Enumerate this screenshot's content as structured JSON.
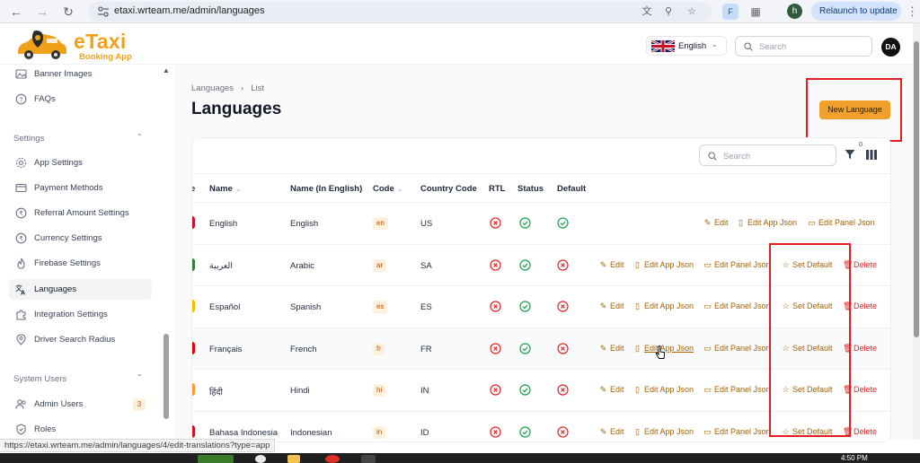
{
  "browser": {
    "url": "etaxi.wrteam.me/admin/languages",
    "relaunch_label": "Relaunch to update",
    "profile_initial": "h",
    "extension_label": "F",
    "status_bar_url": "https://etaxi.wrteam.me/admin/languages/4/edit-translations?type=app"
  },
  "header": {
    "logo_title": "eTaxi",
    "logo_subtitle": "Booking App",
    "language_label": "English",
    "search_placeholder": "Search",
    "avatar_initials": "DA"
  },
  "sidebar": {
    "items_top": [
      {
        "label": "Banner Images",
        "icon": "image-icon"
      },
      {
        "label": "FAQs",
        "icon": "help-circle-icon"
      }
    ],
    "settings_group": "Settings",
    "settings_items": [
      {
        "label": "App Settings",
        "icon": "gear-icon"
      },
      {
        "label": "Payment Methods",
        "icon": "credit-card-icon"
      },
      {
        "label": "Referral Amount Settings",
        "icon": "coin-icon"
      },
      {
        "label": "Currency Settings",
        "icon": "currency-icon"
      },
      {
        "label": "Firebase Settings",
        "icon": "flame-icon"
      },
      {
        "label": "Languages",
        "icon": "translate-icon",
        "active": true
      },
      {
        "label": "Integration Settings",
        "icon": "puzzle-icon"
      },
      {
        "label": "Driver Search Radius",
        "icon": "map-pin-icon"
      }
    ],
    "system_users_group": "System Users",
    "system_users_items": [
      {
        "label": "Admin Users",
        "icon": "users-icon",
        "badge": "3"
      },
      {
        "label": "Roles",
        "icon": "shield-icon"
      }
    ]
  },
  "page": {
    "breadcrumb": [
      "Languages",
      "List"
    ],
    "title": "Languages",
    "new_button_label": "New Language"
  },
  "table": {
    "search_placeholder": "Search",
    "filter_count": "0",
    "columns": {
      "flag": "e",
      "name": "Name",
      "name_en": "Name (In English)",
      "code": "Code",
      "country_code": "Country Code",
      "rtl": "RTL",
      "status": "Status",
      "default": "Default"
    },
    "actions": {
      "edit": "Edit",
      "edit_app_json": "Edit App Json",
      "edit_panel_json": "Edit Panel Json",
      "set_default": "Set Default",
      "delete": "Delete"
    },
    "rows": [
      {
        "name": "English",
        "name_en": "English",
        "code": "en",
        "country": "US",
        "rtl": false,
        "status": true,
        "is_default": true,
        "flag_color": "#c8102e"
      },
      {
        "name": "العربية",
        "name_en": "Arabic",
        "code": "ar",
        "country": "SA",
        "rtl": false,
        "status": true,
        "is_default": false,
        "flag_color": "#3a7d44"
      },
      {
        "name": "Español",
        "name_en": "Spanish",
        "code": "es",
        "country": "ES",
        "rtl": false,
        "status": true,
        "is_default": false,
        "flag_color": "#f1bf00"
      },
      {
        "name": "Français",
        "name_en": "French",
        "code": "fr",
        "country": "FR",
        "rtl": false,
        "status": true,
        "is_default": false,
        "flag_color": "#e1000f"
      },
      {
        "name": "हिंदी",
        "name_en": "Hindi",
        "code": "hi",
        "country": "IN",
        "rtl": false,
        "status": true,
        "is_default": false,
        "flag_color": "#ff9933"
      },
      {
        "name": "Bahasa Indonesia",
        "name_en": "Indonesian",
        "code": "in",
        "country": "ID",
        "rtl": false,
        "status": true,
        "is_default": false,
        "flag_color": "#ce1126"
      }
    ]
  },
  "taskbar": {
    "time": "4:50 PM"
  },
  "colors": {
    "brand": "#f0a11a",
    "primary_button": "#f0a02b",
    "action_text": "#a16207",
    "danger": "#dc2626",
    "success": "#16a34a",
    "highlight": "#e11d1d"
  }
}
